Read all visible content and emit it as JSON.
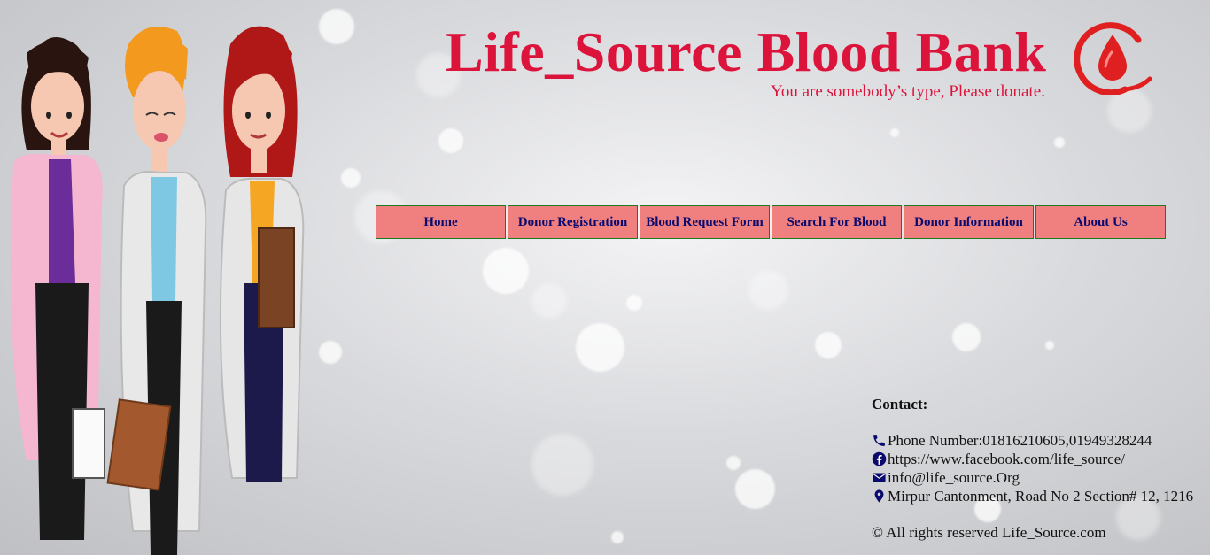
{
  "header": {
    "title": "Life_Source Blood Bank",
    "tagline": "You are somebody’s type, Please donate."
  },
  "nav": {
    "items": [
      {
        "label": "Home"
      },
      {
        "label": "Donor Registration"
      },
      {
        "label": "Blood Request Form"
      },
      {
        "label": "Search For Blood"
      },
      {
        "label": "Donor Information"
      },
      {
        "label": "About Us"
      }
    ]
  },
  "contact": {
    "heading": "Contact:",
    "phone": "Phone Number:01816210605,01949328244",
    "facebook": "https://www.facebook.com/life_source/",
    "email": "info@life_source.Org",
    "address": "Mirpur Cantonment, Road No 2 Section# 12, 1216",
    "copyright": "© All rights reserved Life_Source.com"
  },
  "colors": {
    "title": "#dc143c",
    "nav_bg": "#f08080",
    "nav_text": "#0a0a6e",
    "nav_border": "#1e7a1e",
    "icon": "#0a0a6e"
  },
  "icons": {
    "logo": "blood-drop-logo",
    "phone": "phone-icon",
    "facebook": "facebook-icon",
    "email": "envelope-icon",
    "address": "map-marker-icon"
  }
}
